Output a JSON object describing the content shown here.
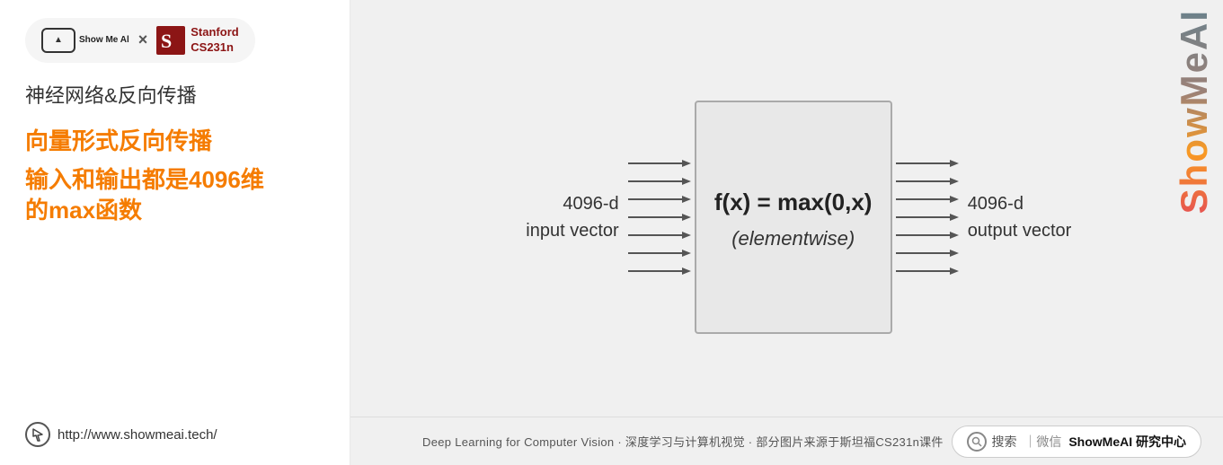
{
  "left": {
    "logo": {
      "showmeai_text": "Show Me Al",
      "times": "×",
      "stanford_line1": "Stanford",
      "stanford_line2": "CS231n"
    },
    "section_title": "神经网络&反向传播",
    "highlight_title": "向量形式反向传播",
    "highlight_subtitle": "输入和输出都是4096维\n的max函数",
    "website_url": "http://www.showmeai.tech/"
  },
  "diagram": {
    "input_label_line1": "4096-d",
    "input_label_line2": "input vector",
    "function_line1": "f(x) = max(0,x)",
    "function_line2": "(elementwise)",
    "output_label_line1": "4096-d",
    "output_label_line2": "output vector",
    "watermark": "ShowMeAI"
  },
  "bottom": {
    "left_text": "Deep Learning for Computer Vision · 深度学习与计算机视觉 · 部分图片来源于斯坦福CS231n课件",
    "search_prefix": "搜索",
    "search_divider": "｜微信",
    "search_brand": "ShowMeAI 研究中心"
  }
}
